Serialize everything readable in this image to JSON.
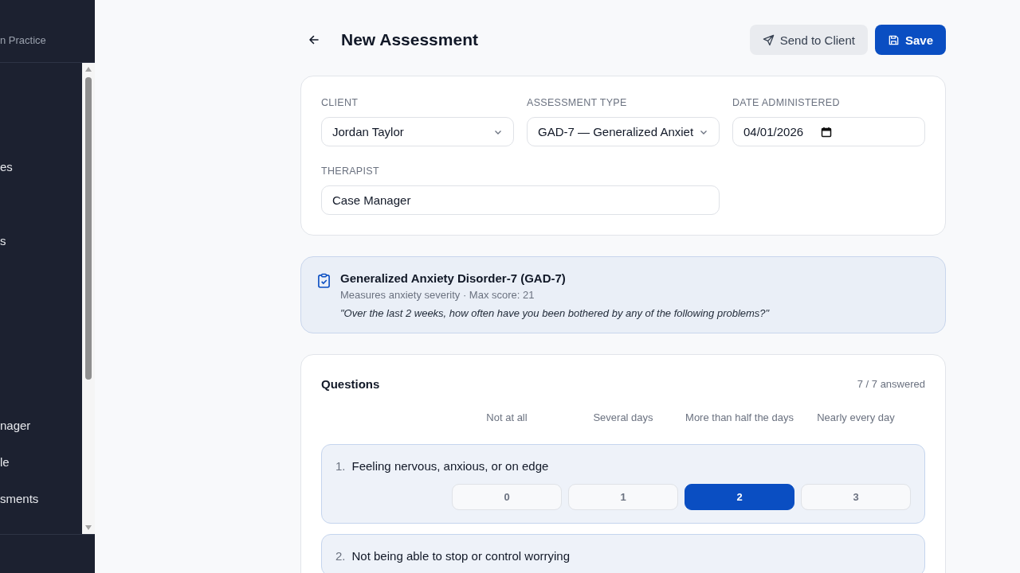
{
  "sidebar": {
    "subtitle": "n Practice",
    "items": [
      {
        "label": "es"
      },
      {
        "label": "s"
      },
      {
        "label": "nager"
      },
      {
        "label": "le"
      },
      {
        "label": "sments"
      }
    ]
  },
  "header": {
    "title": "New Assessment",
    "buttons": [
      {
        "label": "Send to Client",
        "kind": "secondary"
      },
      {
        "label": "Save",
        "kind": "primary"
      }
    ]
  },
  "form": {
    "fields": [
      {
        "label": "CLIENT",
        "value": "Jordan Taylor",
        "kind": "select"
      },
      {
        "label": "ASSESSMENT TYPE",
        "value": "GAD-7 — Generalized Anxiet",
        "kind": "select"
      },
      {
        "label": "DATE ADMINISTERED",
        "value": "04/01/2026",
        "kind": "date"
      },
      {
        "label": "THERAPIST",
        "value": "Case Manager",
        "kind": "text"
      }
    ]
  },
  "info": {
    "title": "Generalized Anxiety Disorder-7 (GAD-7)",
    "subtitle": "Measures anxiety severity · Max score: 21",
    "prompt": "\"Over the last 2 weeks, how often have you been bothered by any of the following problems?\""
  },
  "questions": {
    "title": "Questions",
    "count": "7 / 7 answered",
    "options": [
      "Not at all",
      "Several days",
      "More than half the days",
      "Nearly every day"
    ],
    "items": [
      {
        "number": "1.",
        "text": "Feeling nervous, anxious, or on edge",
        "answers": [
          {
            "label": "0",
            "selected": false
          },
          {
            "label": "1",
            "selected": false
          },
          {
            "label": "2",
            "selected": true
          },
          {
            "label": "3",
            "selected": false
          }
        ]
      },
      {
        "number": "2.",
        "text": "Not being able to stop or control worrying"
      }
    ]
  }
}
